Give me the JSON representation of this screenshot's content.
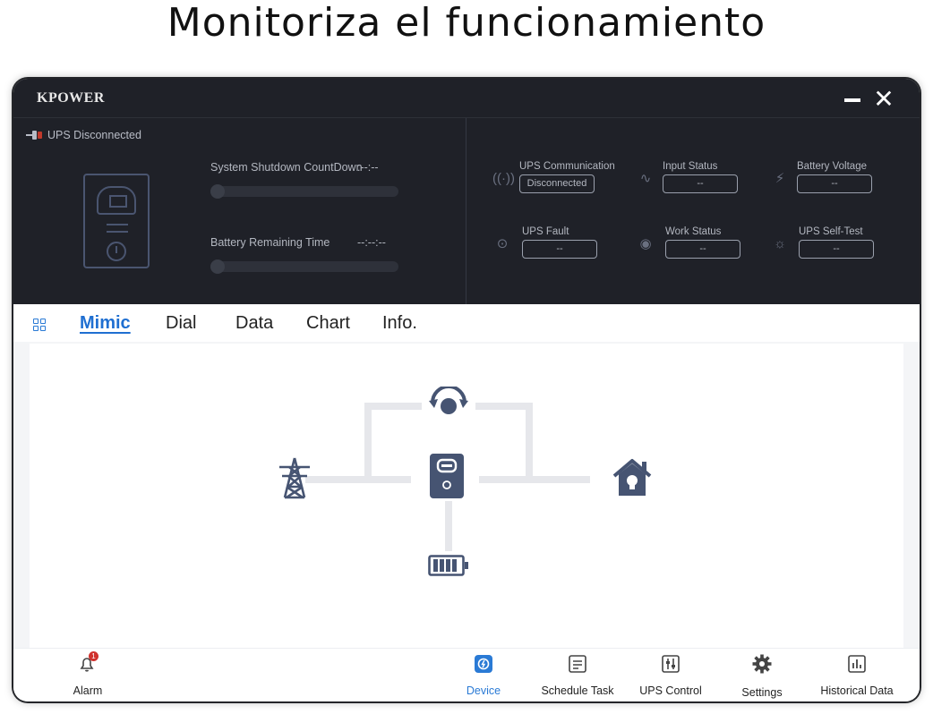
{
  "headline": "Monitoriza el funcionamiento",
  "window": {
    "title": "KPOWER"
  },
  "status": {
    "connection": "UPS Disconnected"
  },
  "countdown": {
    "label": "System Shutdown CountDown",
    "value": ":--:--"
  },
  "battery_time": {
    "label": "Battery Remaining Time",
    "value": "--:--:--"
  },
  "indicators": [
    {
      "label": "UPS Communication",
      "value": "Disconnected",
      "icon": "antenna-icon"
    },
    {
      "label": "Input Status",
      "value": "--",
      "icon": "ac-wave-icon"
    },
    {
      "label": "Battery Voltage",
      "value": "--",
      "icon": "battery-charge-icon"
    },
    {
      "label": "UPS Fault",
      "value": "--",
      "icon": "fault-icon"
    },
    {
      "label": "Work Status",
      "value": "--",
      "icon": "work-status-icon"
    },
    {
      "label": "UPS Self-Test",
      "value": "--",
      "icon": "bug-icon"
    }
  ],
  "tabs": [
    {
      "label": "Mimic",
      "active": true
    },
    {
      "label": "Dial",
      "active": false
    },
    {
      "label": "Data",
      "active": false
    },
    {
      "label": "Chart",
      "active": false
    },
    {
      "label": "Info.",
      "active": false
    }
  ],
  "bottom_nav": {
    "alarm": {
      "label": "Alarm",
      "badge": "1"
    },
    "device": {
      "label": "Device",
      "active": true
    },
    "schedule": {
      "label": "Schedule Task"
    },
    "ups_control": {
      "label": "UPS Control"
    },
    "settings": {
      "label": "Settings"
    },
    "historical": {
      "label": "Historical Data"
    }
  },
  "colors": {
    "header_bg": "#1f2128",
    "accent": "#1f6fd1",
    "diagram_icon": "#465472",
    "badge": "#d0312d"
  }
}
